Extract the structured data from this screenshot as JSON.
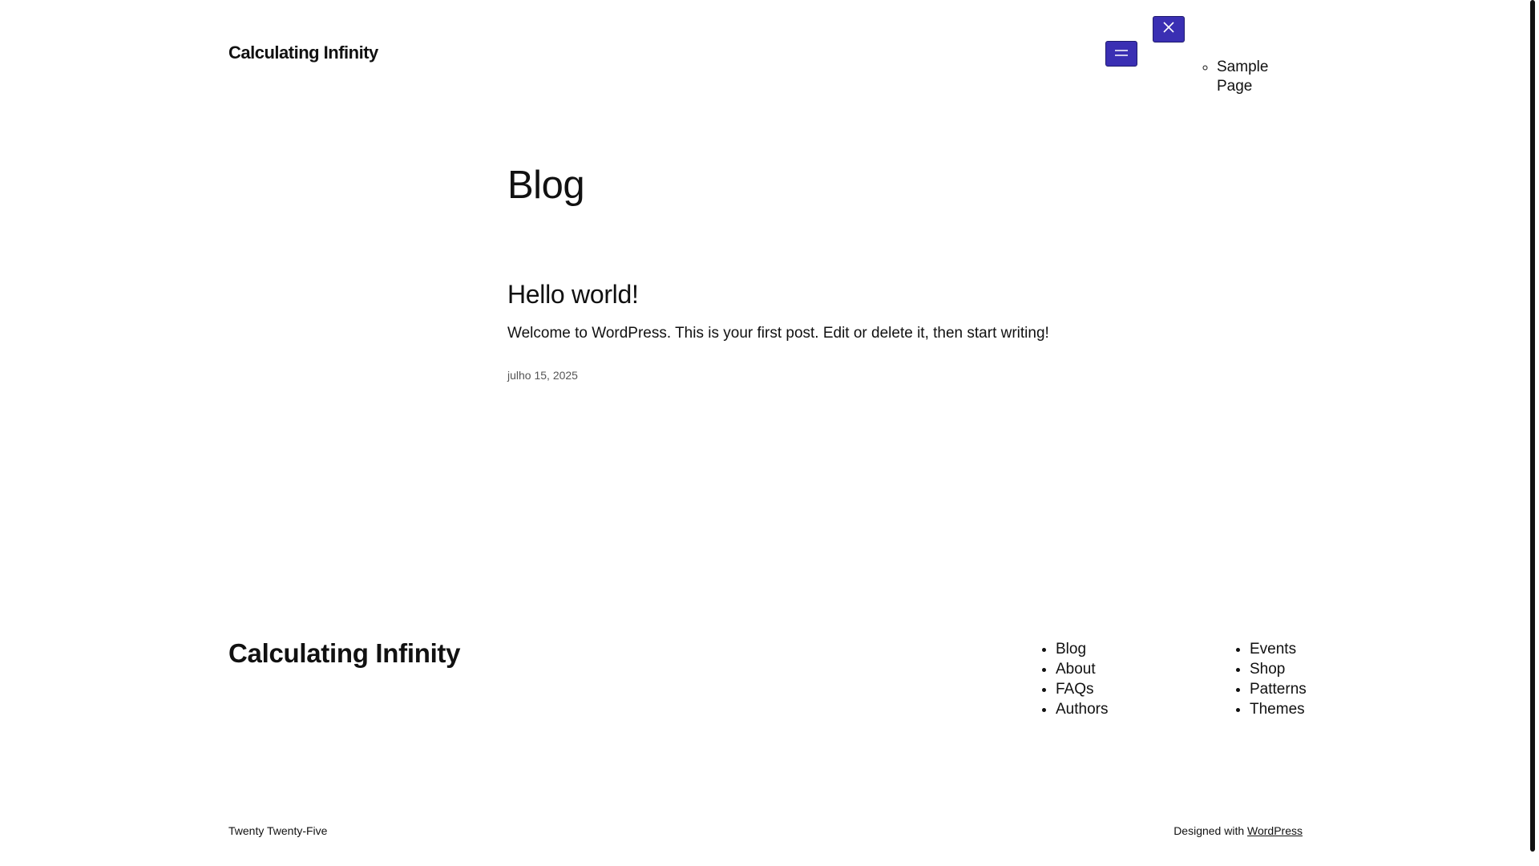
{
  "header": {
    "site_title": "Calculating Infinity",
    "nav_items": [
      "Sample Page"
    ]
  },
  "main": {
    "page_title": "Blog",
    "posts": [
      {
        "title": "Hello world!",
        "excerpt": "Welcome to WordPress. This is your first post. Edit or delete it, then start writing!",
        "date": "julho 15, 2025"
      }
    ]
  },
  "footer": {
    "site_title": "Calculating Infinity",
    "nav_column_1": [
      "Blog",
      "About",
      "FAQs",
      "Authors"
    ],
    "nav_column_2": [
      "Events",
      "Shop",
      "Patterns",
      "Themes"
    ],
    "theme_name": "Twenty Twenty-Five",
    "credit_prefix": "Designed with",
    "credit_link": "WordPress"
  },
  "colors": {
    "button_bg": "#3a2fb3",
    "text": "#111111",
    "muted_text": "#555555"
  },
  "icons": {
    "menu_open": "hamburger-icon",
    "menu_close": "close-icon"
  }
}
